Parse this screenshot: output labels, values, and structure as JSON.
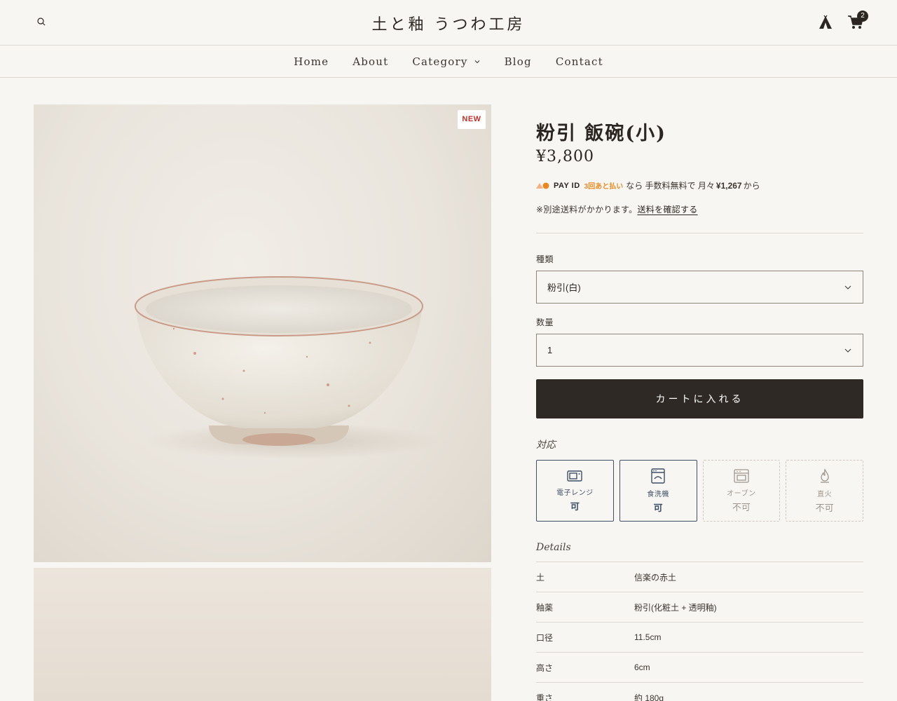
{
  "header": {
    "logo": "土と釉 うつわ工房",
    "cart_count": "2",
    "icons": [
      "search-icon",
      "tent-icon",
      "cart-icon"
    ]
  },
  "nav": {
    "items": [
      {
        "label": "Home"
      },
      {
        "label": "About"
      },
      {
        "label": "Category"
      },
      {
        "label": "Blog"
      },
      {
        "label": "Contact"
      }
    ]
  },
  "product": {
    "badge": "NEW",
    "title": "粉引 飯碗(小)",
    "price": "¥3,800",
    "payid": {
      "brand": "PAY ID",
      "later": "3回あと払い",
      "text": "なら 手数料無料で 月々",
      "monthly": "¥1,267",
      "suffix": "から"
    },
    "shipping_note": "※別途送料がかかります。",
    "shipping_link": "送料を確認する",
    "variant": {
      "label": "種類",
      "value": "粉引(白)"
    },
    "quantity": {
      "label": "数量",
      "value": "1"
    },
    "add_to_cart": "カートに入れる"
  },
  "support": {
    "title": "対応",
    "tiles": [
      {
        "name": "電子レンジ",
        "value": "可",
        "ok": true,
        "icon": "microwave-icon"
      },
      {
        "name": "食洗機",
        "value": "可",
        "ok": true,
        "icon": "dishwasher-icon"
      },
      {
        "name": "オーブン",
        "value": "不可",
        "ok": false,
        "icon": "oven-icon"
      },
      {
        "name": "直火",
        "value": "不可",
        "ok": false,
        "icon": "flame-icon"
      }
    ]
  },
  "details": {
    "title": "Details",
    "rows": [
      {
        "key": "土",
        "value": "信楽の赤土"
      },
      {
        "key": "釉薬",
        "value": "粉引(化粧土 + 透明釉)"
      },
      {
        "key": "口径",
        "value": "11.5cm"
      },
      {
        "key": "高さ",
        "value": "6cm"
      },
      {
        "key": "重さ",
        "value": "約 180g"
      }
    ]
  },
  "colors": {
    "background": "#f8f6f2",
    "text": "#2b2622",
    "button": "#2e2924",
    "ok_accent": "#3e4f66",
    "new_badge": "#b8342c",
    "payid_accent": "#e8891f"
  }
}
